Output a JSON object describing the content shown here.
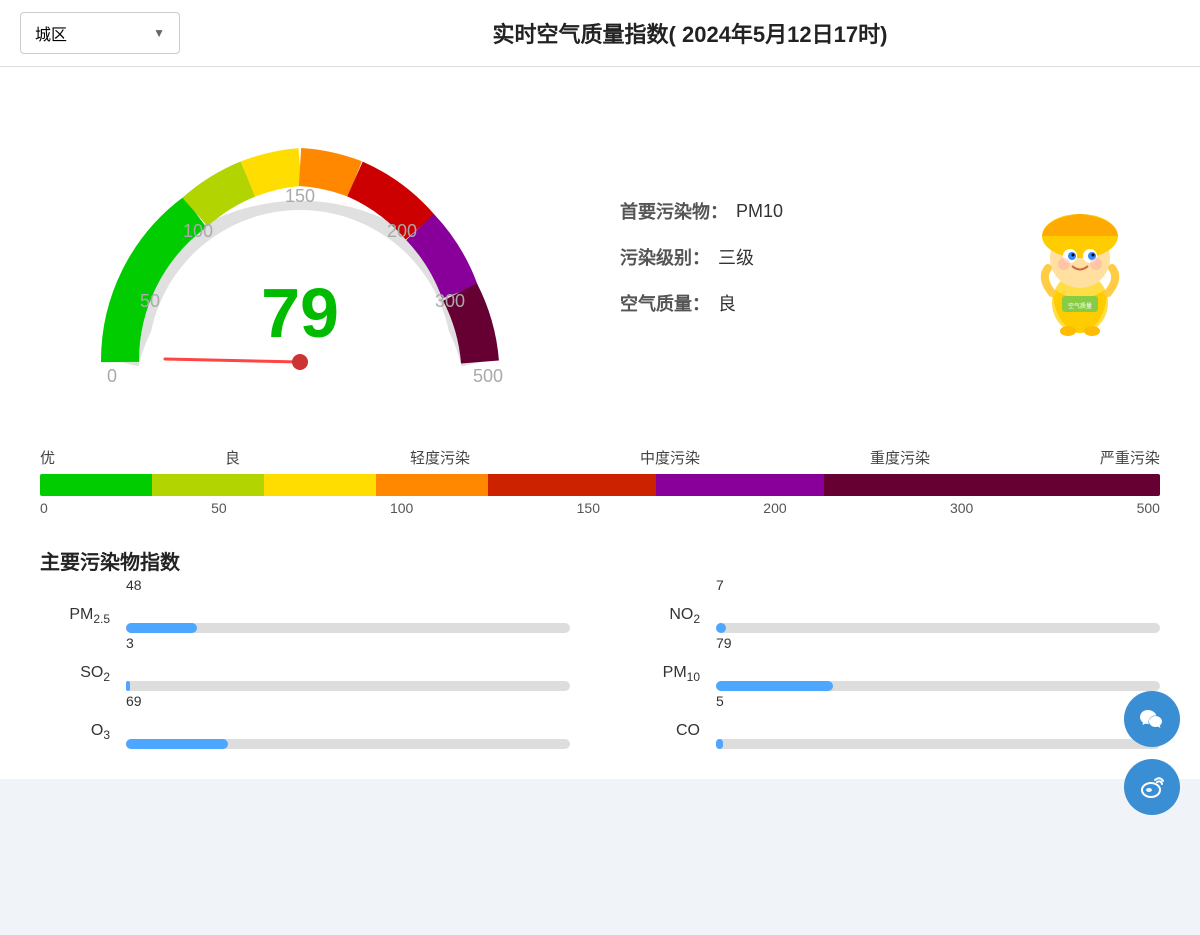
{
  "header": {
    "district_label": "城区",
    "dropdown_arrow": "▼",
    "title": "实时空气质量指数( 2024年5月12日17时)"
  },
  "gauge": {
    "value": "79",
    "labels": [
      "0",
      "50",
      "100",
      "150",
      "200",
      "300",
      "500"
    ],
    "needle_angle": -60
  },
  "info": {
    "primary_pollutant_label": "首要污染物：",
    "primary_pollutant_value": "PM10",
    "pollution_level_label": "污染级别：",
    "pollution_level_value": "三级",
    "air_quality_label": "空气质量：",
    "air_quality_value": "良"
  },
  "scale": {
    "labels": [
      "优",
      "良",
      "轻度污染",
      "中度污染",
      "重度污染",
      "严重污染"
    ],
    "numbers": [
      "0",
      "50",
      "100",
      "150",
      "200",
      "300",
      "500"
    ]
  },
  "pollutants": {
    "title": "主要污染物指数",
    "items": [
      {
        "name": "PM",
        "sub": "2.5",
        "value": 48,
        "max": 300,
        "id": "pm25"
      },
      {
        "name": "NO",
        "sub": "2",
        "value": 7,
        "max": 300,
        "id": "no2"
      },
      {
        "name": "SO",
        "sub": "2",
        "value": 3,
        "max": 300,
        "id": "so2"
      },
      {
        "name": "PM",
        "sub": "10",
        "value": 79,
        "max": 300,
        "id": "pm10"
      },
      {
        "name": "O",
        "sub": "3",
        "value": 69,
        "max": 300,
        "id": "o3"
      },
      {
        "name": "CO",
        "sub": "",
        "value": 5,
        "max": 300,
        "id": "co"
      }
    ]
  },
  "float_buttons": [
    {
      "icon": "💬",
      "label": "wechat-button"
    },
    {
      "icon": "📡",
      "label": "weibo-button"
    }
  ]
}
